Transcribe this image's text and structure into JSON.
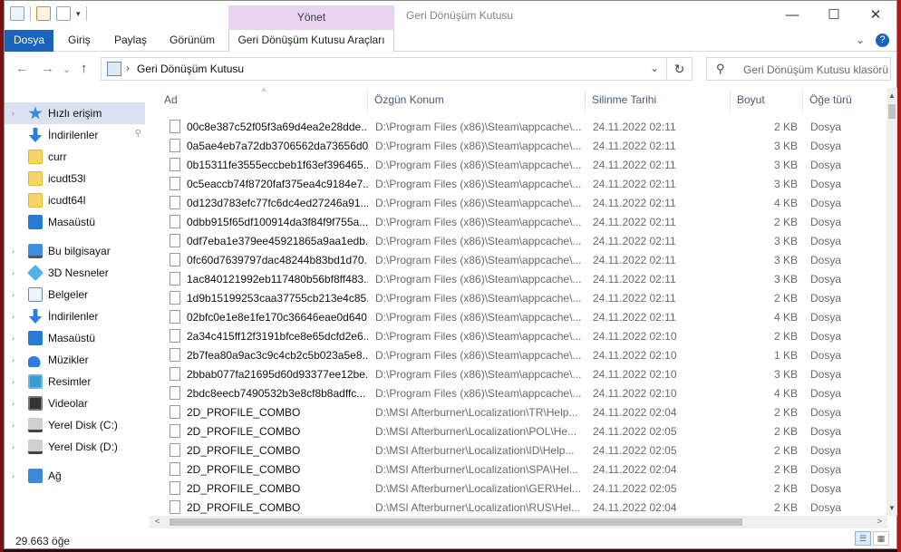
{
  "window": {
    "title": "Geri Dönüşüm Kutusu",
    "manage_tab": "Yönet",
    "controls": {
      "minimize": "—",
      "maximize": "☐",
      "close": "✕"
    }
  },
  "ribbon": {
    "tabs": [
      "Dosya",
      "Giriş",
      "Paylaş",
      "Görünüm"
    ],
    "tools_tab": "Geri Dönüşüm Kutusu Araçları",
    "expand_glyph": "⌄",
    "help_glyph": "?"
  },
  "nav": {
    "back": "←",
    "forward": "→",
    "recent": "⌄",
    "up": "↑",
    "address": "Geri Dönüşüm Kutusu",
    "address_chevron": "›",
    "dropdown": "⌄",
    "refresh": "↻",
    "search_glyph": "⚲",
    "search_placeholder": "Geri Dönüşüm Kutusu klasörü"
  },
  "sidebar": {
    "items": [
      {
        "label": "Hızlı erişim",
        "icon": "star-icon"
      },
      {
        "label": "İndirilenler",
        "icon": "download-icon"
      },
      {
        "label": "curr",
        "icon": "folder-icon"
      },
      {
        "label": "icudt53l",
        "icon": "folder-icon"
      },
      {
        "label": "icudt64l",
        "icon": "folder-icon"
      },
      {
        "label": "Masaüstü",
        "icon": "desktop-icon"
      },
      {
        "label": "Bu bilgisayar",
        "icon": "computer-icon"
      },
      {
        "label": "3D Nesneler",
        "icon": "3d-objects-icon"
      },
      {
        "label": "Belgeler",
        "icon": "documents-icon"
      },
      {
        "label": "İndirilenler",
        "icon": "download-icon"
      },
      {
        "label": "Masaüstü",
        "icon": "desktop-icon"
      },
      {
        "label": "Müzikler",
        "icon": "music-icon"
      },
      {
        "label": "Resimler",
        "icon": "pictures-icon"
      },
      {
        "label": "Videolar",
        "icon": "videos-icon"
      },
      {
        "label": "Yerel Disk (C:)",
        "icon": "disk-icon"
      },
      {
        "label": "Yerel Disk (D:)",
        "icon": "disk-icon"
      },
      {
        "label": "Ağ",
        "icon": "network-icon"
      }
    ],
    "expand_glyph": "›",
    "pin_glyph": "📌"
  },
  "columns": {
    "name": "Ad",
    "location": "Özgün Konum",
    "deleted": "Silinme Tarihi",
    "size": "Boyut",
    "type": "Öğe türü",
    "sort_glyph": "^"
  },
  "rows": [
    {
      "name": "00c8e387c52f05f3a69d4ea2e28dde...",
      "loc": "D:\\Program Files (x86)\\Steam\\appcache\\...",
      "date": "24.11.2022 02:11",
      "size": "2 KB",
      "type": "Dosya"
    },
    {
      "name": "0a5ae4eb7a72db3706562da73656d0...",
      "loc": "D:\\Program Files (x86)\\Steam\\appcache\\...",
      "date": "24.11.2022 02:11",
      "size": "3 KB",
      "type": "Dosya"
    },
    {
      "name": "0b15311fe3555eccbeb1f63ef396465...",
      "loc": "D:\\Program Files (x86)\\Steam\\appcache\\...",
      "date": "24.11.2022 02:11",
      "size": "3 KB",
      "type": "Dosya"
    },
    {
      "name": "0c5eaccb74f8720faf375ea4c9184e7...",
      "loc": "D:\\Program Files (x86)\\Steam\\appcache\\...",
      "date": "24.11.2022 02:11",
      "size": "3 KB",
      "type": "Dosya"
    },
    {
      "name": "0d123d783efc77fc6dc4ed27246a91...",
      "loc": "D:\\Program Files (x86)\\Steam\\appcache\\...",
      "date": "24.11.2022 02:11",
      "size": "4 KB",
      "type": "Dosya"
    },
    {
      "name": "0dbb915f65df100914da3f84f9f755a...",
      "loc": "D:\\Program Files (x86)\\Steam\\appcache\\...",
      "date": "24.11.2022 02:11",
      "size": "2 KB",
      "type": "Dosya"
    },
    {
      "name": "0df7eba1e379ee45921865a9aa1edb...",
      "loc": "D:\\Program Files (x86)\\Steam\\appcache\\...",
      "date": "24.11.2022 02:11",
      "size": "3 KB",
      "type": "Dosya"
    },
    {
      "name": "0fc60d7639797dac48244b83bd1d70...",
      "loc": "D:\\Program Files (x86)\\Steam\\appcache\\...",
      "date": "24.11.2022 02:11",
      "size": "3 KB",
      "type": "Dosya"
    },
    {
      "name": "1ac840121992eb117480b56bf8ff483...",
      "loc": "D:\\Program Files (x86)\\Steam\\appcache\\...",
      "date": "24.11.2022 02:11",
      "size": "3 KB",
      "type": "Dosya"
    },
    {
      "name": "1d9b15199253caa37755cb213e4c85...",
      "loc": "D:\\Program Files (x86)\\Steam\\appcache\\...",
      "date": "24.11.2022 02:11",
      "size": "2 KB",
      "type": "Dosya"
    },
    {
      "name": "02bfc0e1e8e1fe170c36646eae0d640...",
      "loc": "D:\\Program Files (x86)\\Steam\\appcache\\...",
      "date": "24.11.2022 02:11",
      "size": "4 KB",
      "type": "Dosya"
    },
    {
      "name": "2a34c415ff12f3191bfce8e65dcfd2e6...",
      "loc": "D:\\Program Files (x86)\\Steam\\appcache\\...",
      "date": "24.11.2022 02:10",
      "size": "2 KB",
      "type": "Dosya"
    },
    {
      "name": "2b7fea80a9ac3c9c4cb2c5b023a5e8...",
      "loc": "D:\\Program Files (x86)\\Steam\\appcache\\...",
      "date": "24.11.2022 02:10",
      "size": "1 KB",
      "type": "Dosya"
    },
    {
      "name": "2bbab077fa21695d60d93377ee12be...",
      "loc": "D:\\Program Files (x86)\\Steam\\appcache\\...",
      "date": "24.11.2022 02:10",
      "size": "3 KB",
      "type": "Dosya"
    },
    {
      "name": "2bdc8eecb7490532b3e8cf8b8adffc...",
      "loc": "D:\\Program Files (x86)\\Steam\\appcache\\...",
      "date": "24.11.2022 02:10",
      "size": "4 KB",
      "type": "Dosya"
    },
    {
      "name": "2D_PROFILE_COMBO",
      "loc": "D:\\MSI Afterburner\\Localization\\TR\\Help...",
      "date": "24.11.2022 02:04",
      "size": "2 KB",
      "type": "Dosya"
    },
    {
      "name": "2D_PROFILE_COMBO",
      "loc": "D:\\MSI Afterburner\\Localization\\POL\\He...",
      "date": "24.11.2022 02:05",
      "size": "2 KB",
      "type": "Dosya"
    },
    {
      "name": "2D_PROFILE_COMBO",
      "loc": "D:\\MSI Afterburner\\Localization\\ID\\Help...",
      "date": "24.11.2022 02:05",
      "size": "2 KB",
      "type": "Dosya"
    },
    {
      "name": "2D_PROFILE_COMBO",
      "loc": "D:\\MSI Afterburner\\Localization\\SPA\\Hel...",
      "date": "24.11.2022 02:04",
      "size": "2 KB",
      "type": "Dosya"
    },
    {
      "name": "2D_PROFILE_COMBO",
      "loc": "D:\\MSI Afterburner\\Localization\\GER\\Hel...",
      "date": "24.11.2022 02:05",
      "size": "2 KB",
      "type": "Dosya"
    },
    {
      "name": "2D_PROFILE_COMBO",
      "loc": "D:\\MSI Afterburner\\Localization\\RUS\\Hel...",
      "date": "24.11.2022 02:04",
      "size": "2 KB",
      "type": "Dosya"
    }
  ],
  "scroll": {
    "up": "▲",
    "down": "▼",
    "left": "<",
    "right": ">"
  },
  "status": {
    "count": "29.663 öğe",
    "details_view": "☰",
    "icons_view": "▦"
  }
}
